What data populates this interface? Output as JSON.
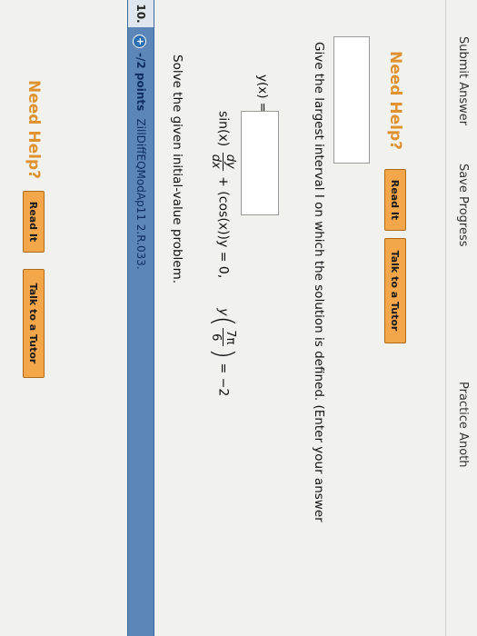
{
  "top": {
    "need_help_label": "Need Help?",
    "read_it_label": "Read It",
    "talk_tutor_label": "Talk to a Tutor"
  },
  "question": {
    "number": "10.",
    "plus_label": "+",
    "points": "-/2 points",
    "code": "ZillDiffEQModAp11 2.R.033.",
    "prompt": "Solve the given initial-value problem.",
    "equation": {
      "lhs_start": "sin(x)",
      "frac_num": "dy",
      "frac_den": "dx",
      "middle": "+ (cos(x))y = 0,",
      "cond_start": "y",
      "cond_num": "7π",
      "cond_den": "6",
      "cond_end": "= −2"
    },
    "answer_label": "y(x) =",
    "answer_value": "",
    "interval_prompt": "Give the largest interval I on which the solution is defined. (Enter your answer",
    "interval_value": ""
  },
  "help2": {
    "need_help_label": "Need Help?",
    "read_it_label": "Read It",
    "talk_tutor_label": "Talk to a Tutor"
  },
  "footer": {
    "submit_label": "Submit Answer",
    "save_label": "Save Progress",
    "practice_label": "Practice Anoth"
  }
}
